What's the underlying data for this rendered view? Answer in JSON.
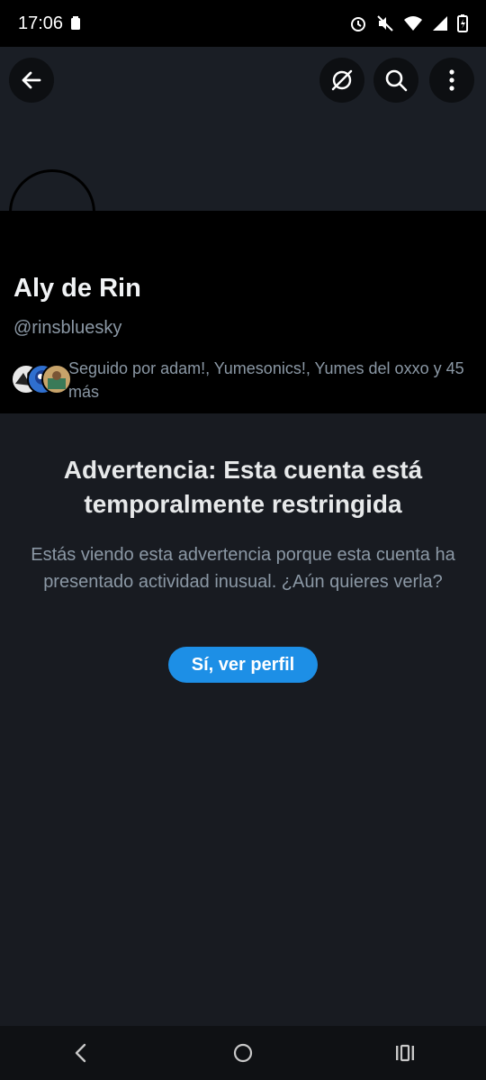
{
  "status_bar": {
    "time": "17:06",
    "icons": [
      "battery-saver-icon",
      "alarm-icon",
      "mute-icon",
      "wifi-icon",
      "signal-icon",
      "battery-charging-icon"
    ]
  },
  "header": {
    "back_icon": "back-arrow-icon",
    "translate_icon": "feed-off-icon",
    "search_icon": "search-icon",
    "more_icon": "more-vertical-icon"
  },
  "profile": {
    "display_name": "Aly de Rin",
    "handle": "@rinsbluesky",
    "followed_by": "Seguido por adam!, Yumesonics!, Yumes del oxxo y 45 más"
  },
  "warning": {
    "title": "Advertencia: Esta cuenta está temporalmente restringida",
    "message": "Estás viendo esta advertencia porque esta cuenta ha presentado actividad inusual. ¿Aún quieres verla?",
    "button": "Sí, ver perfil"
  },
  "colors": {
    "accent": "#1d8fe6",
    "background": "#181b21",
    "muted_text": "#8b98a5"
  },
  "nav_bar": {
    "back": "nav-back-icon",
    "home": "nav-home-icon",
    "recents": "nav-recents-icon"
  }
}
